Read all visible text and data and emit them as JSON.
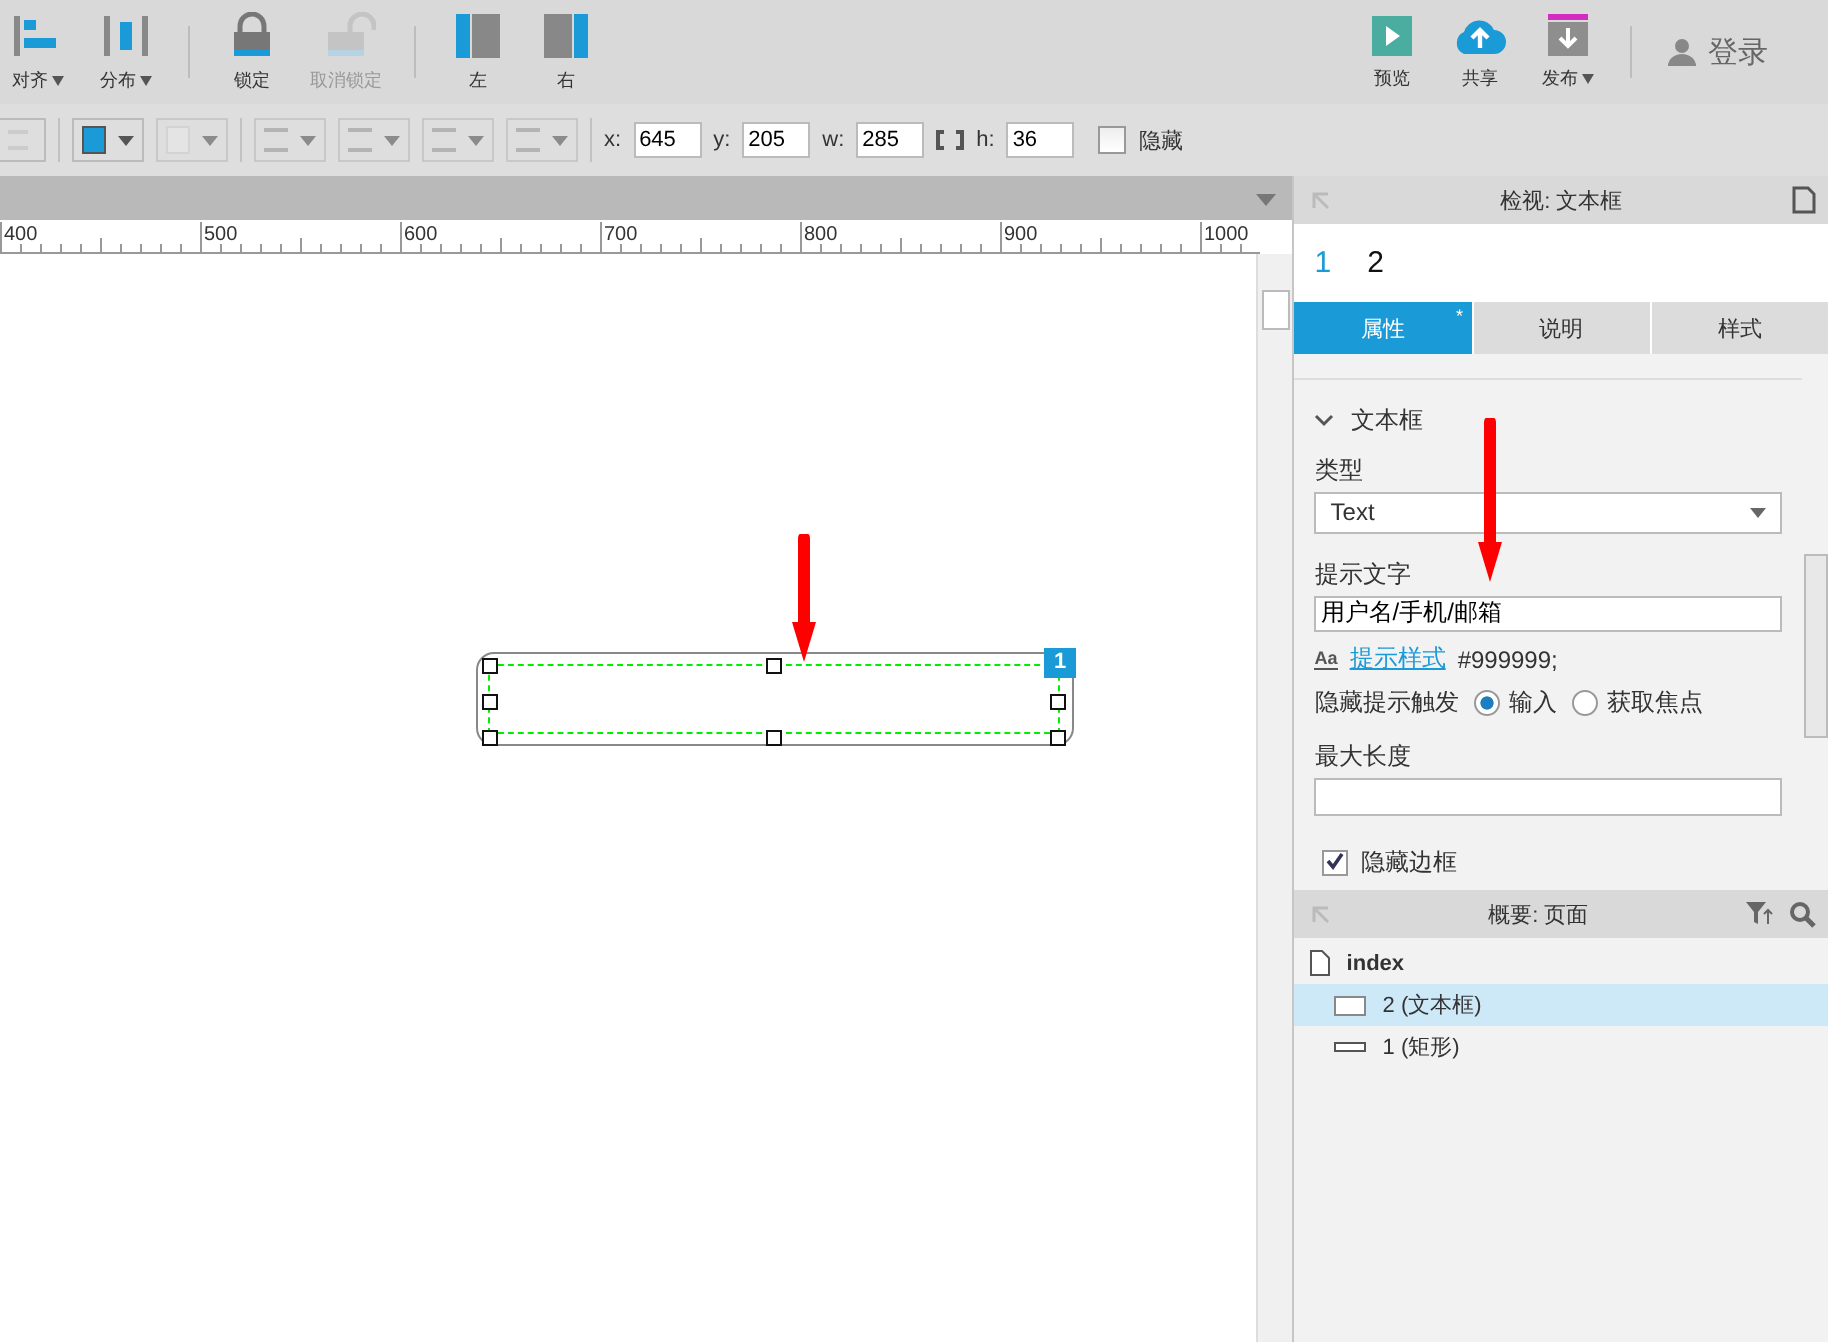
{
  "toolbar": {
    "left_tools": [
      {
        "kind": "align",
        "label": "对齐",
        "dropdown": true,
        "disabled": false
      },
      {
        "kind": "distribute",
        "label": "分布",
        "dropdown": true,
        "disabled": false
      },
      {
        "kind": "lock",
        "label": "锁定",
        "dropdown": false,
        "disabled": false
      },
      {
        "kind": "unlock",
        "label": "取消锁定",
        "dropdown": false,
        "disabled": true
      },
      {
        "kind": "left",
        "label": "左",
        "dropdown": false,
        "disabled": false
      },
      {
        "kind": "right",
        "label": "右",
        "dropdown": false,
        "disabled": false
      }
    ],
    "right_tools": [
      {
        "kind": "preview",
        "label": "预览",
        "dropdown": false
      },
      {
        "kind": "share",
        "label": "共享",
        "dropdown": false
      },
      {
        "kind": "publish",
        "label": "发布",
        "dropdown": true
      }
    ],
    "login": "登录"
  },
  "format_bar": {
    "fields": [
      {
        "label": "x:",
        "value": "645"
      },
      {
        "label": "y:",
        "value": "205"
      },
      {
        "label": "w:",
        "value": "285"
      },
      {
        "label": "h:",
        "value": "36"
      }
    ],
    "hidden": {
      "label": "隐藏",
      "checked": false
    }
  },
  "ruler": {
    "labels": [
      "400",
      "500",
      "600",
      "700",
      "800",
      "900",
      "1000"
    ]
  },
  "canvas": {
    "widget_badge": "1"
  },
  "inspector": {
    "title": "检视: 文本框",
    "pages": [
      {
        "label": "1",
        "selected": true
      },
      {
        "label": "2",
        "selected": false
      }
    ],
    "tabs": [
      {
        "label": "属性",
        "marker": "*",
        "selected": true
      },
      {
        "label": "说明",
        "selected": false
      },
      {
        "label": "样式",
        "selected": false
      }
    ],
    "section": {
      "title": "文本框",
      "expanded": true
    },
    "type_label": "类型",
    "type_value": "Text",
    "hint_field": {
      "label": "提示文字",
      "value": "用户名/手机/邮箱"
    },
    "hint_style_icon": "Aa",
    "hint_style_link": "提示样式",
    "hint_style_value": "#999999;",
    "hide_trigger_label": "隐藏提示触发",
    "hide_trigger_options": [
      {
        "label": "输入",
        "selected": true
      },
      {
        "label": "获取焦点",
        "selected": false
      }
    ],
    "max_length_label": "最大长度",
    "hide_border": {
      "label": "隐藏边框",
      "checked": true
    }
  },
  "outline": {
    "title": "概要: 页面",
    "items": [
      {
        "label": "index",
        "kind": "page",
        "selected": false,
        "children": [
          {
            "label": "2 (文本框)",
            "kind": "textbox",
            "selected": true
          },
          {
            "label": "1 (矩形)",
            "kind": "rectangle",
            "selected": false
          }
        ]
      }
    ]
  }
}
